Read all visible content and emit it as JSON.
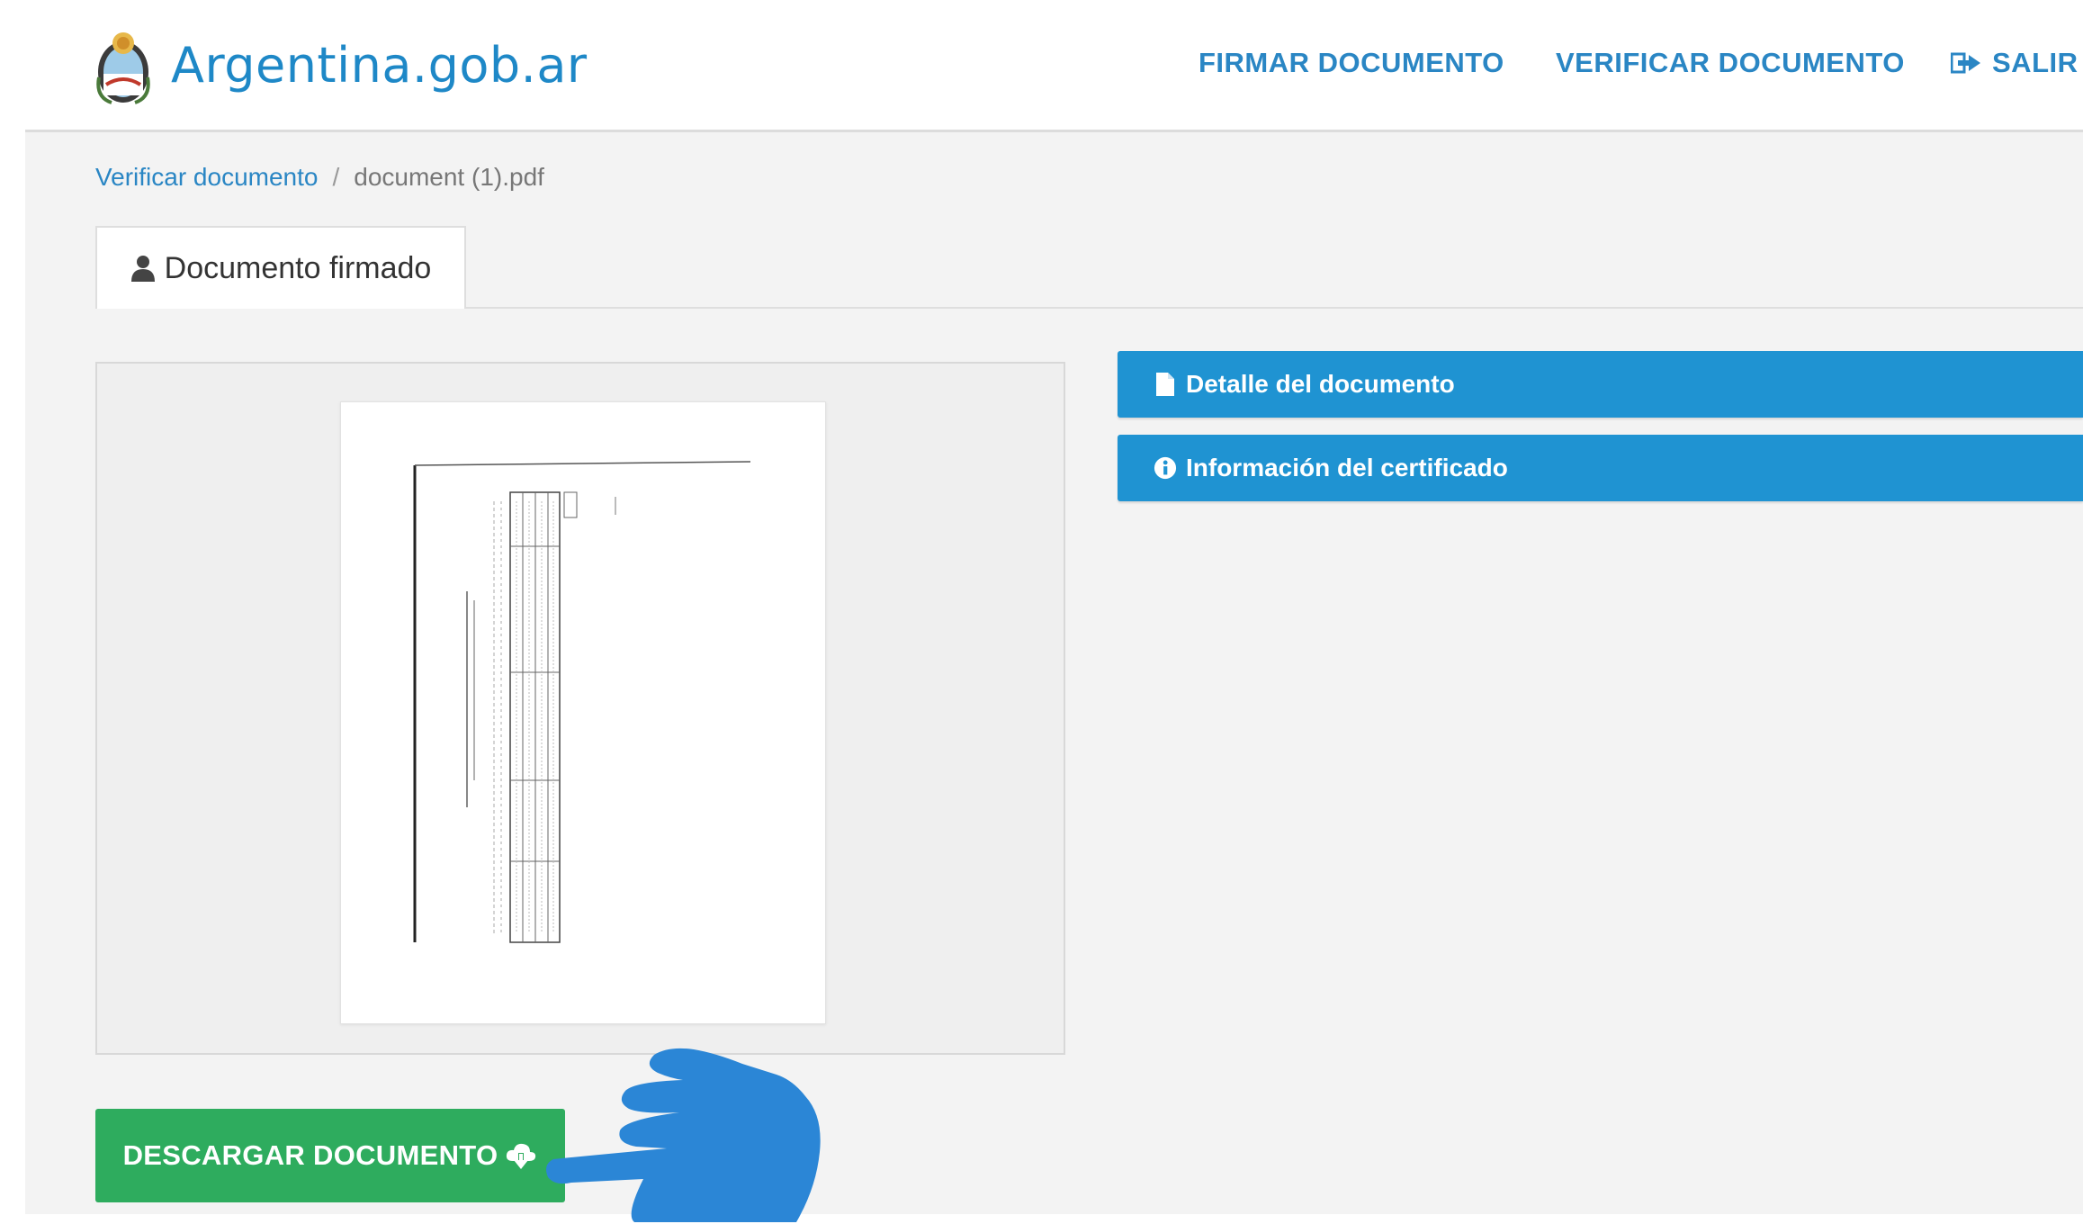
{
  "header": {
    "logo_text": "Argentina.gob.ar",
    "nav": {
      "firmar": "FIRMAR DOCUMENTO",
      "verificar": "VERIFICAR DOCUMENTO",
      "salir": "SALIR"
    }
  },
  "breadcrumb": {
    "parent": "Verificar documento",
    "separator": "/",
    "current": "document (1).pdf"
  },
  "tab": {
    "label": "Documento firmado"
  },
  "accordions": [
    {
      "label": "Detalle del documento",
      "icon": "file-icon"
    },
    {
      "label": "Información del certificado",
      "icon": "info-icon"
    }
  ],
  "download_button": {
    "label": "DESCARGAR DOCUMENTO",
    "icon": "cloud-download-icon"
  },
  "colors": {
    "brand_blue": "#1e88c7",
    "accordion_blue": "#1f93d2",
    "download_green": "#2eac5e",
    "pointer_blue": "#2b86d6"
  }
}
